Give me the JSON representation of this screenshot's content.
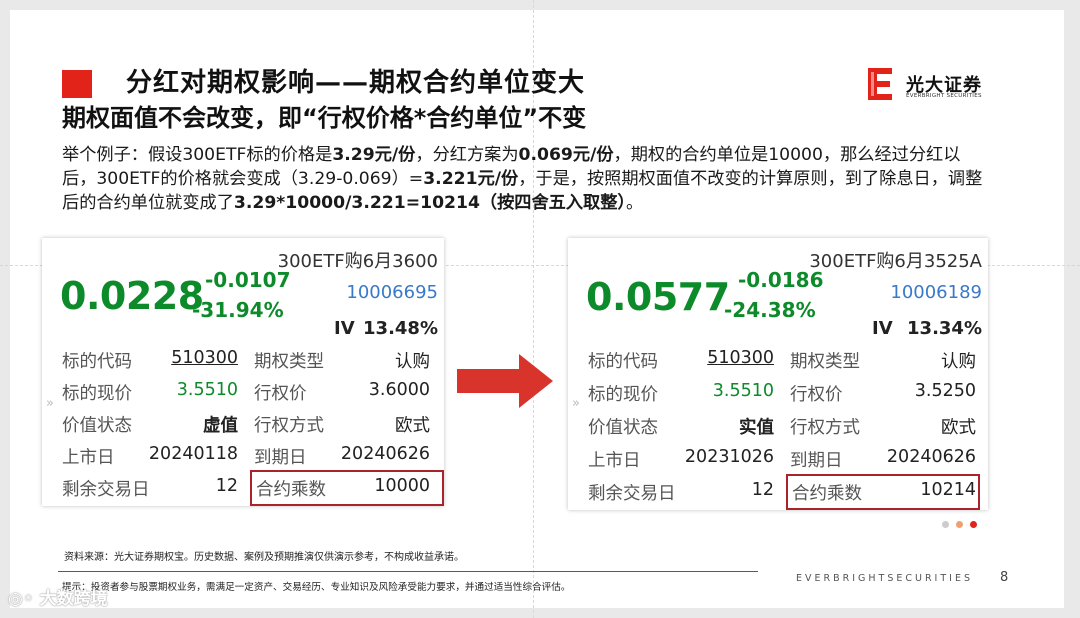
{
  "slide": {
    "title_line1": "分红对期权影响——期权合约单位变大",
    "title_line2": "期权面值不会改变，即“行权价格*合约单位”不变",
    "logo_cn": "光大证券",
    "logo_en": "EVERBRIGHT SECURITIES",
    "para": {
      "p1": "举个例子：假设300ETF标的价格是",
      "b1": "3.29元/份",
      "p2": "，分红方案为",
      "b2": "0.069元/份",
      "p3": "，期权的合约单位是10000，那么经过分红以后，300ETF的价格就会变成（3.29-0.069）=",
      "b3": "3.221元/份",
      "p4": "，于是，按照期权面值不改变的计算原则，到了除息日，调整后的合约单位就变成了",
      "b4": "3.29*10000/3.221=10214（按四舍五入取整）",
      "p5": "。"
    },
    "source": "资料来源：光大证券期权宝。历史数据、案例及预期推演仅供演示参考，不构成收益承诺。",
    "tip": "提示：投资者参与股票期权业务，需满足一定资产、交易经历、专业知识及风险承受能力要求，并通过适当性综合评估。",
    "footer_brand": "EVERBRIGHTSECURITIES",
    "page_number": "8",
    "watermark": "大数跨境"
  },
  "cards": {
    "left": {
      "name": "300ETF购6月3600",
      "price": "0.0228",
      "change": "-0.0107",
      "change_pct": "-31.94%",
      "code": "10006695",
      "iv_label": "IV",
      "iv_value": "13.48%",
      "rows": [
        {
          "l1": "标的代码",
          "v1": "510300",
          "l2": "期权类型",
          "v2": "认购"
        },
        {
          "l1": "标的现价",
          "v1": "3.5510",
          "l2": "行权价",
          "v2": "3.6000"
        },
        {
          "l1": "价值状态",
          "v1": "虚值",
          "l2": "行权方式",
          "v2": "欧式"
        },
        {
          "l1": "上市日",
          "v1": "20240118",
          "l2": "到期日",
          "v2": "20240626"
        },
        {
          "l1": "剩余交易日",
          "v1": "12",
          "l2": "合约乘数",
          "v2": "10000"
        }
      ]
    },
    "right": {
      "name": "300ETF购6月3525A",
      "price": "0.0577",
      "change": "-0.0186",
      "change_pct": "-24.38%",
      "code": "10006189",
      "iv_label": "IV",
      "iv_value": "13.34%",
      "rows": [
        {
          "l1": "标的代码",
          "v1": "510300",
          "l2": "期权类型",
          "v2": "认购"
        },
        {
          "l1": "标的现价",
          "v1": "3.5510",
          "l2": "行权价",
          "v2": "3.5250"
        },
        {
          "l1": "价值状态",
          "v1": "实值",
          "l2": "行权方式",
          "v2": "欧式"
        },
        {
          "l1": "上市日",
          "v1": "20231026",
          "l2": "到期日",
          "v2": "20240626"
        },
        {
          "l1": "剩余交易日",
          "v1": "12",
          "l2": "合约乘数",
          "v2": "10214"
        }
      ]
    }
  },
  "colors": {
    "brand_red": "#e2231a",
    "price_green": "#0d8a2a",
    "code_blue": "#3a78c8",
    "highlight_box": "#a8232a",
    "dots": [
      "#cccccc",
      "#f0a070",
      "#e2231a"
    ]
  }
}
